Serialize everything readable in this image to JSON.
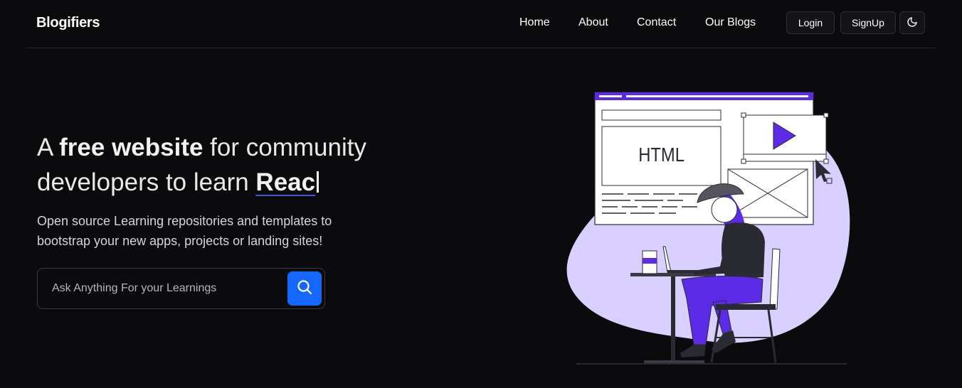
{
  "brand": "Blogifiers",
  "nav": {
    "links": [
      "Home",
      "About",
      "Contact",
      "Our Blogs"
    ],
    "login_label": "Login",
    "signup_label": "SignUp",
    "theme_icon": "moon-icon"
  },
  "hero": {
    "title_prefix": "A ",
    "title_bold": "free website",
    "title_mid": " for community developers to learn ",
    "typed_word": "Reac",
    "subtitle": "Open source Learning repositories and templates to bootstrap your new apps, projects or landing sites!"
  },
  "search": {
    "placeholder": "Ask Anything For your Learnings",
    "value": "",
    "icon": "search-icon"
  },
  "illustration": {
    "code_label": "HTML",
    "colors": {
      "accent": "#5b2be8",
      "blob": "#d9d0ff",
      "search_button": "#1468ff"
    }
  }
}
